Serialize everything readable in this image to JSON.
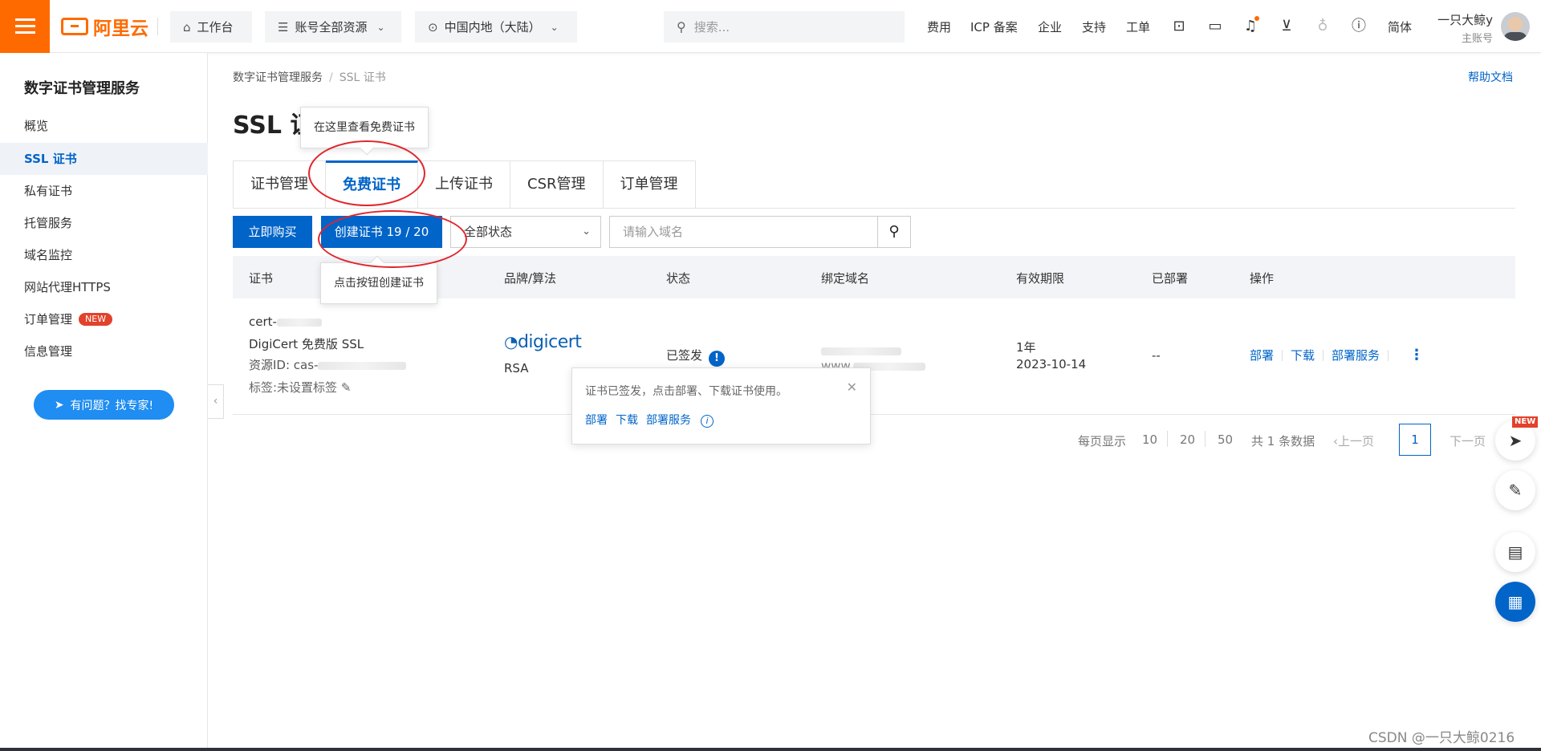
{
  "topbar": {
    "logo_text": "阿里云",
    "workbench": "工作台",
    "account_resources": "账号全部资源",
    "region": "中国内地（大陆）",
    "search_placeholder": "搜索...",
    "links": [
      "费用",
      "ICP 备案",
      "企业",
      "支持",
      "工单"
    ],
    "language": "简体",
    "user_name": "一只大鲸y",
    "user_role": "主账号",
    "accent_color": "#ff6a00"
  },
  "sidebar": {
    "title": "数字证书管理服务",
    "items": [
      {
        "label": "概览"
      },
      {
        "label": "SSL 证书",
        "active": true
      },
      {
        "label": "私有证书"
      },
      {
        "label": "托管服务"
      },
      {
        "label": "域名监控"
      },
      {
        "label": "网站代理HTTPS"
      },
      {
        "label": "订单管理",
        "badge": "NEW"
      },
      {
        "label": "信息管理"
      }
    ],
    "help_button": "有问题？找专家!"
  },
  "breadcrumb": {
    "root": "数字证书管理服务",
    "current": "SSL 证书"
  },
  "help_doc": "帮助文档",
  "page_title": "SSL 证书",
  "tooltip_free_cert": "在这里查看免费证书",
  "tooltip_create": "点击按钮创建证书",
  "tabs": [
    {
      "label": "证书管理"
    },
    {
      "label": "免费证书",
      "active": true
    },
    {
      "label": "上传证书"
    },
    {
      "label": "CSR管理"
    },
    {
      "label": "订单管理"
    }
  ],
  "toolbar": {
    "buy_now": "立即购买",
    "create_cert": "创建证书 19 / 20",
    "status_select": "全部状态",
    "domain_placeholder": "请输入域名"
  },
  "table": {
    "headers": [
      "证书",
      "品牌/算法",
      "状态",
      "绑定域名",
      "有效期限",
      "已部署",
      "操作"
    ],
    "rows": [
      {
        "cert_name": "cert-",
        "cert_type": "DigiCert 免费版 SSL",
        "resource_id": "资源ID: cas-",
        "tags": "标签:未设置标签",
        "brand": "digicert",
        "algorithm": "RSA",
        "status": "已签发",
        "domain": "www.",
        "validity": "1年",
        "expiry": "2023-10-14",
        "deployed": "--",
        "actions": [
          "部署",
          "下载",
          "部署服务"
        ]
      }
    ]
  },
  "popover": {
    "message": "证书已签发，点击部署、下载证书使用。",
    "actions": [
      "部署",
      "下载",
      "部署服务"
    ]
  },
  "pagination": {
    "per_page_label": "每页显示",
    "sizes": [
      "10",
      "20",
      "50"
    ],
    "total": "共 1 条数据",
    "prev": "上一页",
    "current": "1",
    "next": "下一页"
  },
  "floating": {
    "new_badge": "NEW"
  },
  "watermark": "CSDN @一只大鲸0216"
}
